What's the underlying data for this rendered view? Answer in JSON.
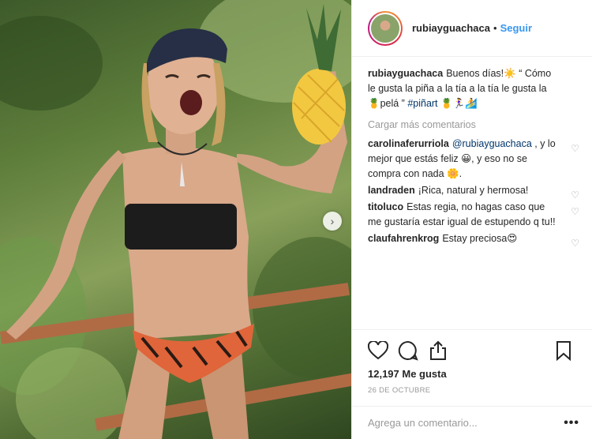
{
  "post": {
    "username": "rubiayguachaca",
    "separator": "•",
    "follow_label": "Seguir",
    "caption": {
      "user": "rubiayguachaca",
      "text_1": "Buenos días!☀️ “ Cómo le gusta la piña a la tía a la tía le gusta la 🍍pelá ” ",
      "hashtag": "#piñart",
      "text_2": " 🍍🏃‍♀️🏄"
    },
    "load_more_label": "Cargar más comentarios",
    "comments": [
      {
        "user": "carolinaferurriola",
        "mention": "@rubiayguachaca",
        "text": " , y lo mejor que estás feliz 😀, y eso no se compra con nada 🌼."
      },
      {
        "user": "landraden",
        "text": "¡Rica, natural y hermosa!"
      },
      {
        "user": "titoluco",
        "text": "Estas regia, no hagas caso que me gustaría estar igual de estupendo q tu!!"
      },
      {
        "user": "claufahrenkrog",
        "text": "Estay preciosa😍"
      }
    ],
    "likes_label": "12,197 Me gusta",
    "date_label": "26 DE OCTUBRE",
    "comment_placeholder": "Agrega un comentario...",
    "more_label": "•••",
    "next_arrow": "›"
  },
  "icons": {
    "like": "heart-icon",
    "comment": "comment-icon",
    "share": "share-icon",
    "save": "bookmark-icon",
    "small_like": "heart-icon"
  },
  "colors": {
    "link": "#3897f0",
    "hashtag": "#003569",
    "secondary": "#999999",
    "text": "#262626",
    "divider": "#efefef"
  }
}
